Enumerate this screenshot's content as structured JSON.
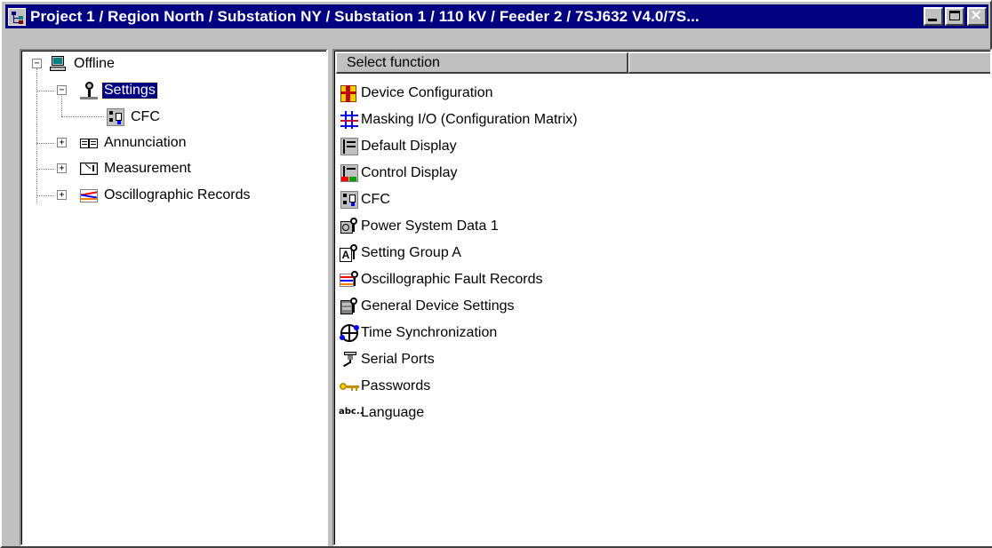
{
  "window": {
    "title": "Project 1 / Region North / Substation NY / Substation 1 / 110 kV / Feeder 2 / 7SJ632 V4.0/7S...",
    "icon": "tree-structure-icon",
    "buttons": {
      "minimize": "minimize-button",
      "maximize": "maximize-button",
      "close": "close-button"
    }
  },
  "tree": {
    "root": {
      "label": "Offline",
      "icon": "computer-icon",
      "expanded": true
    },
    "nodes": [
      {
        "label": "Settings",
        "icon": "settings-icon",
        "expanded": true,
        "selected": true
      },
      {
        "label": "CFC",
        "icon": "cfc-icon",
        "child_of": "Settings"
      },
      {
        "label": "Annunciation",
        "icon": "book-icon",
        "expanded": false
      },
      {
        "label": "Measurement",
        "icon": "meter-icon",
        "expanded": false
      },
      {
        "label": "Oscillographic Records",
        "icon": "waveform-icon",
        "expanded": false
      }
    ]
  },
  "list": {
    "header": "Select function",
    "items": [
      {
        "label": "Device Configuration",
        "icon": "device-config-icon"
      },
      {
        "label": "Masking I/O (Configuration Matrix)",
        "icon": "matrix-icon"
      },
      {
        "label": "Default Display",
        "icon": "default-display-icon"
      },
      {
        "label": "Control Display",
        "icon": "control-display-icon"
      },
      {
        "label": "CFC",
        "icon": "cfc-icon"
      },
      {
        "label": "Power System Data 1",
        "icon": "power-system-data-icon"
      },
      {
        "label": "Setting Group A",
        "icon": "setting-group-icon"
      },
      {
        "label": "Oscillographic Fault Records",
        "icon": "fault-records-icon"
      },
      {
        "label": "General Device Settings",
        "icon": "general-settings-icon"
      },
      {
        "label": "Time Synchronization",
        "icon": "time-sync-icon"
      },
      {
        "label": "Serial Ports",
        "icon": "serial-port-icon"
      },
      {
        "label": "Passwords",
        "icon": "key-icon"
      },
      {
        "label": "Language",
        "icon": "language-icon"
      }
    ]
  },
  "colors": {
    "titlebar": "#000080",
    "face": "#c0c0c0",
    "selection": "#000080"
  }
}
